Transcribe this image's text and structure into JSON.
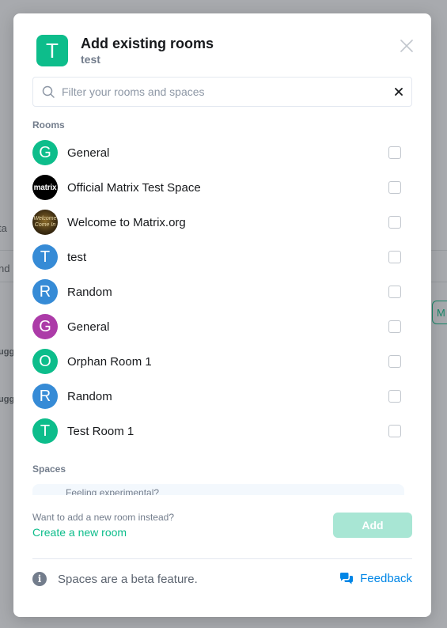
{
  "background": {
    "fragments": [
      "ta",
      "nd",
      "ugg",
      "ugg"
    ],
    "button_label": "M"
  },
  "dialog": {
    "avatar_letter": "T",
    "title": "Add existing rooms",
    "subtitle": "test",
    "close_icon": "close-icon"
  },
  "search": {
    "placeholder": "Filter your rooms and spaces",
    "value": ""
  },
  "rooms_label": "Rooms",
  "rooms": [
    {
      "name": "General",
      "avatar": "G",
      "color": "#0dbd8b",
      "checked": false
    },
    {
      "name": "Official Matrix Test Space",
      "avatar": "matrix",
      "color": "#000000",
      "checked": false
    },
    {
      "name": "Welcome to Matrix.org",
      "avatar": "Welcome Come In",
      "color": "#5a4420",
      "checked": false
    },
    {
      "name": "test",
      "avatar": "T",
      "color": "#368bd6",
      "checked": false
    },
    {
      "name": "Random",
      "avatar": "R",
      "color": "#368bd6",
      "checked": false
    },
    {
      "name": "General",
      "avatar": "G",
      "color": "#ac3ba8",
      "checked": false
    },
    {
      "name": "Orphan Room 1",
      "avatar": "O",
      "color": "#0dbd8b",
      "checked": false
    },
    {
      "name": "Random",
      "avatar": "R",
      "color": "#368bd6",
      "checked": false
    },
    {
      "name": "Test Room 1",
      "avatar": "T",
      "color": "#0dbd8b",
      "checked": false
    }
  ],
  "spaces_label": "Spaces",
  "spaces_preview_text": "Feeling experimental?",
  "footer": {
    "question": "Want to add a new room instead?",
    "create_link": "Create a new room",
    "add_button": "Add",
    "beta_text": "Spaces are a beta feature.",
    "feedback_label": "Feedback"
  },
  "colors": {
    "accent": "#0dbd8b",
    "link_blue": "#0086e6",
    "add_disabled": "#a8e6d4"
  }
}
